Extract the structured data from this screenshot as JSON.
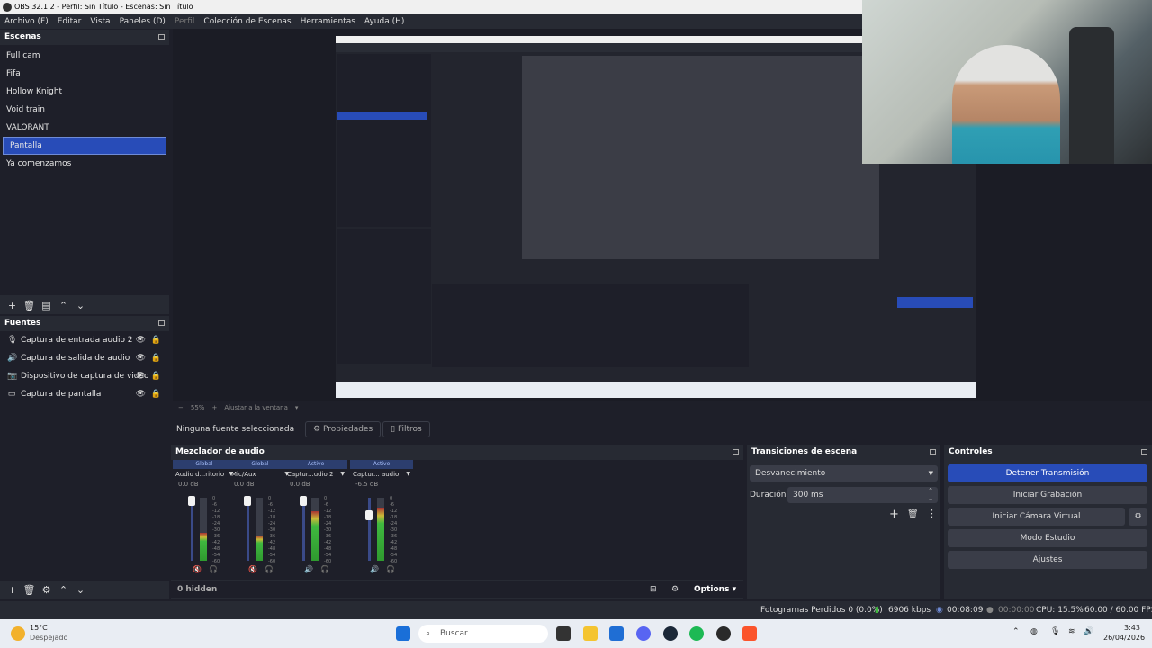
{
  "window": {
    "title": "OBS 32.1.2 - Perfil: Sin Título - Escenas: Sin Título"
  },
  "menu": [
    "Archivo (F)",
    "Editar",
    "Vista",
    "Paneles (D)",
    "Perfil",
    "Colección de Escenas",
    "Herramientas",
    "Ayuda (H)"
  ],
  "scenes": {
    "title": "Escenas",
    "items": [
      "Full cam",
      "Fifa",
      "Hollow Knight",
      "Void train",
      "VALORANT",
      "Pantalla",
      "Ya comenzamos"
    ],
    "selected": "Pantalla"
  },
  "sources": {
    "title": "Fuentes",
    "items": [
      {
        "label": "Captura de entrada audio 2",
        "icon": "microphone-icon"
      },
      {
        "label": "Captura de salida de audio",
        "icon": "speaker-icon"
      },
      {
        "label": "Dispositivo de captura de video",
        "icon": "camera-icon"
      },
      {
        "label": "Captura de pantalla",
        "icon": "monitor-icon"
      }
    ]
  },
  "preview_bar": {
    "zoom": "55%",
    "fit": "Ajustar a la ventana"
  },
  "context_bar": {
    "no_source": "Ninguna fuente seleccionada",
    "properties": "Propiedades",
    "filters": "Filtros"
  },
  "mixer": {
    "title": "Mezclador de audio",
    "channels": [
      {
        "status": "Global",
        "name": "Audio d...ritorio",
        "db": "0.0 dB",
        "level": 0.45,
        "muted": true
      },
      {
        "status": "Global",
        "name": "Mic/Aux",
        "db": "0.0 dB",
        "level": 0.4,
        "muted": true
      },
      {
        "status": "Active",
        "name": "Captur...udio 2",
        "db": "0.0 dB",
        "level": 0.78,
        "muted": false
      },
      {
        "status": "Active",
        "name": "Captur... audio",
        "db": "-6.5 dB",
        "level": 0.85,
        "muted": false
      }
    ],
    "scale": [
      "0",
      "-6",
      "-12",
      "-18",
      "-24",
      "-30",
      "-36",
      "-42",
      "-48",
      "-54",
      "-60"
    ],
    "hidden_label": "0 hidden",
    "options_label": "Options"
  },
  "transitions": {
    "title": "Transiciones de escena",
    "selected": "Desvanecimiento",
    "duration_label": "Duración",
    "duration_value": "300 ms"
  },
  "controls": {
    "title": "Controles",
    "buttons": [
      "Detener Transmisión",
      "Iniciar Grabación",
      "Iniciar Cámara Virtual",
      "Modo Estudio",
      "Ajustes"
    ]
  },
  "status": {
    "dropped": "Fotogramas Perdidos 0 (0.0%)",
    "bitrate": "6906 kbps",
    "stream_time": "00:08:09",
    "rec_time": "00:00:00",
    "cpu": "CPU: 15.5%",
    "fps": "60.00 / 60.00 FPS"
  },
  "taskbar": {
    "weather_temp": "15°C",
    "weather_desc": "Despejado",
    "search": "Buscar",
    "time": "3:43",
    "date": "26/04/2026"
  },
  "colors": {
    "accent": "#284cb8",
    "panel": "#272a33",
    "background": "#1e1f29"
  }
}
